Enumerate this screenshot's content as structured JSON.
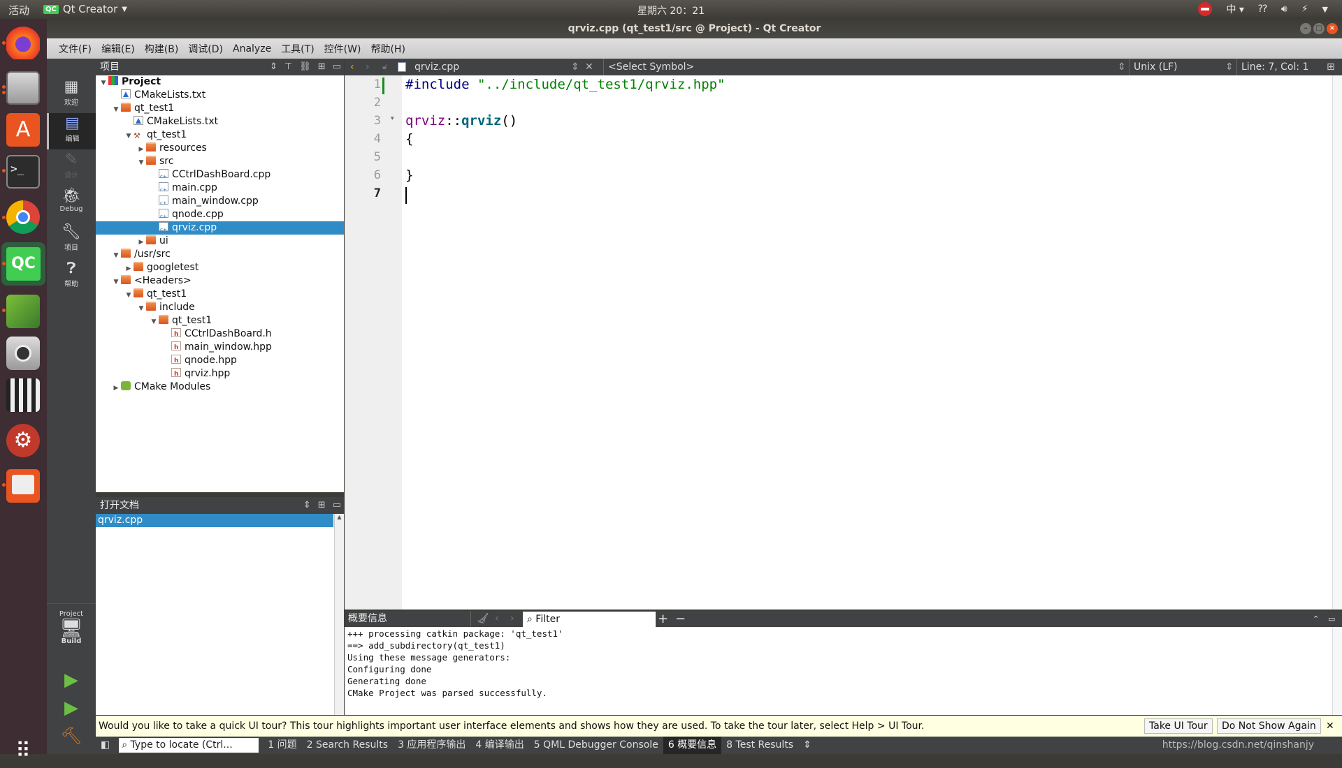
{
  "topbar": {
    "activities": "活动",
    "app_name": "Qt Creator",
    "clock": "星期六 20：21",
    "input_method": "中"
  },
  "window": {
    "title": "qrviz.cpp (qt_test1/src @ Project) - Qt Creator"
  },
  "menu": [
    "文件(F)",
    "编辑(E)",
    "构建(B)",
    "调试(D)",
    "Analyze",
    "工具(T)",
    "控件(W)",
    "帮助(H)"
  ],
  "modes": [
    {
      "label": "欢迎",
      "icon": "grid-icon"
    },
    {
      "label": "编辑",
      "icon": "edit-icon",
      "active": true
    },
    {
      "label": "设计",
      "icon": "pencil-icon",
      "disabled": true
    },
    {
      "label": "Debug",
      "icon": "bug-icon"
    },
    {
      "label": "项目",
      "icon": "wrench-icon"
    },
    {
      "label": "帮助",
      "icon": "help-icon"
    }
  ],
  "kit": {
    "project": "Project",
    "build": "Build"
  },
  "project_pane": {
    "title": "项目",
    "tree": [
      {
        "label": "Project",
        "depth": 0,
        "type": "project",
        "expanded": true,
        "bold": true
      },
      {
        "label": "CMakeLists.txt",
        "depth": 1,
        "type": "cmake"
      },
      {
        "label": "qt_test1",
        "depth": 1,
        "type": "cmakeproj",
        "expanded": true
      },
      {
        "label": "CMakeLists.txt",
        "depth": 2,
        "type": "cmake"
      },
      {
        "label": "qt_test1",
        "depth": 2,
        "type": "target",
        "expanded": true
      },
      {
        "label": "resources",
        "depth": 3,
        "type": "folder",
        "expanded": false
      },
      {
        "label": "src",
        "depth": 3,
        "type": "folder",
        "expanded": true
      },
      {
        "label": "CCtrlDashBoard.cpp",
        "depth": 4,
        "type": "cpp"
      },
      {
        "label": "main.cpp",
        "depth": 4,
        "type": "cpp"
      },
      {
        "label": "main_window.cpp",
        "depth": 4,
        "type": "cpp"
      },
      {
        "label": "qnode.cpp",
        "depth": 4,
        "type": "cpp"
      },
      {
        "label": "qrviz.cpp",
        "depth": 4,
        "type": "cpp",
        "selected": true
      },
      {
        "label": "ui",
        "depth": 3,
        "type": "folder",
        "expanded": false
      },
      {
        "label": "/usr/src",
        "depth": 1,
        "type": "folder",
        "expanded": true
      },
      {
        "label": "googletest",
        "depth": 2,
        "type": "cmakeproj",
        "expanded": false
      },
      {
        "label": "<Headers>",
        "depth": 1,
        "type": "headers",
        "expanded": true
      },
      {
        "label": "qt_test1",
        "depth": 2,
        "type": "folder",
        "expanded": true
      },
      {
        "label": "include",
        "depth": 3,
        "type": "folder",
        "expanded": true
      },
      {
        "label": "qt_test1",
        "depth": 4,
        "type": "folder",
        "expanded": true
      },
      {
        "label": "CCtrlDashBoard.h",
        "depth": 5,
        "type": "h"
      },
      {
        "label": "main_window.hpp",
        "depth": 5,
        "type": "h"
      },
      {
        "label": "qnode.hpp",
        "depth": 5,
        "type": "h"
      },
      {
        "label": "qrviz.hpp",
        "depth": 5,
        "type": "h"
      },
      {
        "label": "CMake Modules",
        "depth": 1,
        "type": "modules",
        "expanded": false
      }
    ]
  },
  "open_docs": {
    "title": "打开文档",
    "items": [
      {
        "label": "qrviz.cpp",
        "selected": true
      }
    ]
  },
  "editor": {
    "file": "qrviz.cpp",
    "symbol": "<Select Symbol>",
    "line_ending": "Unix (LF)",
    "position": "Line: 7, Col: 1",
    "current_line": 7,
    "lines": [
      {
        "n": "1",
        "parts": [
          {
            "t": "#include ",
            "c": "#000080"
          },
          {
            "t": "\"../include/qt_test1/qrviz.hpp\"",
            "c": "#008000"
          }
        ]
      },
      {
        "n": "2",
        "parts": []
      },
      {
        "n": "3",
        "fold": true,
        "parts": [
          {
            "t": "qrviz",
            "c": "#800080"
          },
          {
            "t": "::",
            "c": "#000"
          },
          {
            "t": "qrviz",
            "c": "#00677c",
            "b": true
          },
          {
            "t": "()",
            "c": "#000"
          }
        ]
      },
      {
        "n": "4",
        "parts": [
          {
            "t": "{",
            "c": "#000"
          }
        ]
      },
      {
        "n": "5",
        "parts": []
      },
      {
        "n": "6",
        "parts": [
          {
            "t": "}",
            "c": "#000"
          }
        ]
      },
      {
        "n": "7",
        "parts": []
      }
    ]
  },
  "output": {
    "title": "概要信息",
    "filter_placeholder": "Filter",
    "text": "+++ processing catkin package: 'qt_test1'\n==> add_subdirectory(qt_test1)\nUsing these message generators: \nConfiguring done\nGenerating done\nCMake Project was parsed successfully."
  },
  "infobar": {
    "message": "Would you like to take a quick UI tour? This tour highlights important user interface elements and shows how they are used. To take the tour later, select Help > UI Tour.",
    "take_tour": "Take UI Tour",
    "dont_show": "Do Not Show Again"
  },
  "statusbar": {
    "locator_placeholder": "Type to locate (Ctrl...",
    "panes": [
      {
        "label": "1 问题"
      },
      {
        "label": "2 Search Results"
      },
      {
        "label": "3 应用程序输出"
      },
      {
        "label": "4 编译输出"
      },
      {
        "label": "5 QML Debugger Console"
      },
      {
        "label": "6 概要信息",
        "active": true
      },
      {
        "label": "8 Test Results"
      }
    ],
    "watermark": "https://blog.csdn.net/qinshanjy"
  }
}
